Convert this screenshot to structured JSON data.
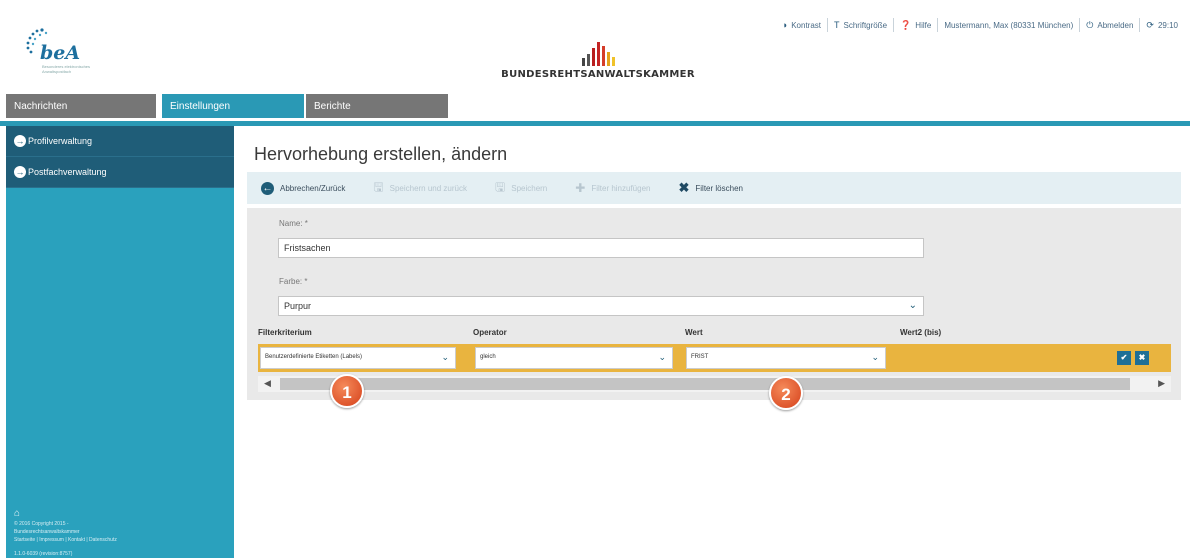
{
  "header": {
    "logo_text": "beA",
    "logo_tagline": "Besonderes elektronisches Anwaltspostfach",
    "brand_name": "BUNDESREHTSANWALTSKAMMER",
    "topbar": {
      "contrast": "Kontrast",
      "font_size": "Schriftgröße",
      "help": "Hilfe",
      "user": "Mustermann, Max (80331 München)",
      "logout": "Abmelden",
      "timer": "29:10"
    }
  },
  "tabs": [
    {
      "label": "Nachrichten"
    },
    {
      "label": "Einstellungen"
    },
    {
      "label": "Berichte"
    }
  ],
  "sidebar": {
    "items": [
      {
        "label": "Profilverwaltung"
      },
      {
        "label": "Postfachverwaltung"
      }
    ],
    "footer": {
      "copyright": "© 2016 Copyright 2015 -",
      "org": "Bundesrechtsanwaltskammer",
      "links": "Startseite | Impressum | Kontakt | Datenschutz",
      "version": "1.1.0-6039 (revision:8757)"
    }
  },
  "main": {
    "title": "Hervorhebung erstellen, ändern",
    "toolbar": {
      "back": "Abbrechen/Zurück",
      "save_back": "Speichern und zurück",
      "save": "Speichern",
      "add_filter": "Filter hinzufügen",
      "delete_filter": "Filter löschen"
    },
    "name_label": "Name: *",
    "name_value": "Fristsachen",
    "color_label": "Farbe: *",
    "color_value": "Purpur",
    "columns": {
      "criterion": "Filterkriterium",
      "operator": "Operator",
      "value": "Wert",
      "value2": "Wert2 (bis)"
    },
    "filter": {
      "criterion": "Benutzerdefinierte Etiketten (Labels)",
      "operator": "gleich",
      "value": "FRIST"
    },
    "markers": [
      "1",
      "2"
    ]
  },
  "colors": {
    "accent": "#2a99b5",
    "sidebar_item": "#1f5d78",
    "filter_row": "#e9b43f",
    "marker": "#d5401a"
  }
}
